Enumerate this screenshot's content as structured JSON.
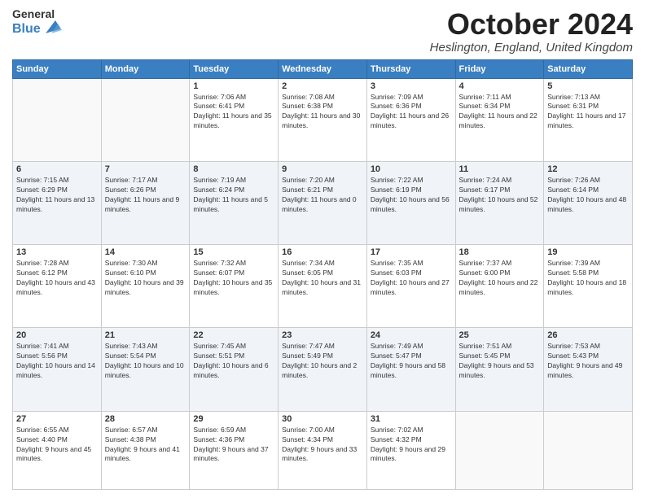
{
  "header": {
    "logo_general": "General",
    "logo_blue": "Blue",
    "month_title": "October 2024",
    "location": "Heslington, England, United Kingdom"
  },
  "days_of_week": [
    "Sunday",
    "Monday",
    "Tuesday",
    "Wednesday",
    "Thursday",
    "Friday",
    "Saturday"
  ],
  "weeks": [
    [
      {
        "day": "",
        "sunrise": "",
        "sunset": "",
        "daylight": ""
      },
      {
        "day": "",
        "sunrise": "",
        "sunset": "",
        "daylight": ""
      },
      {
        "day": "1",
        "sunrise": "Sunrise: 7:06 AM",
        "sunset": "Sunset: 6:41 PM",
        "daylight": "Daylight: 11 hours and 35 minutes."
      },
      {
        "day": "2",
        "sunrise": "Sunrise: 7:08 AM",
        "sunset": "Sunset: 6:38 PM",
        "daylight": "Daylight: 11 hours and 30 minutes."
      },
      {
        "day": "3",
        "sunrise": "Sunrise: 7:09 AM",
        "sunset": "Sunset: 6:36 PM",
        "daylight": "Daylight: 11 hours and 26 minutes."
      },
      {
        "day": "4",
        "sunrise": "Sunrise: 7:11 AM",
        "sunset": "Sunset: 6:34 PM",
        "daylight": "Daylight: 11 hours and 22 minutes."
      },
      {
        "day": "5",
        "sunrise": "Sunrise: 7:13 AM",
        "sunset": "Sunset: 6:31 PM",
        "daylight": "Daylight: 11 hours and 17 minutes."
      }
    ],
    [
      {
        "day": "6",
        "sunrise": "Sunrise: 7:15 AM",
        "sunset": "Sunset: 6:29 PM",
        "daylight": "Daylight: 11 hours and 13 minutes."
      },
      {
        "day": "7",
        "sunrise": "Sunrise: 7:17 AM",
        "sunset": "Sunset: 6:26 PM",
        "daylight": "Daylight: 11 hours and 9 minutes."
      },
      {
        "day": "8",
        "sunrise": "Sunrise: 7:19 AM",
        "sunset": "Sunset: 6:24 PM",
        "daylight": "Daylight: 11 hours and 5 minutes."
      },
      {
        "day": "9",
        "sunrise": "Sunrise: 7:20 AM",
        "sunset": "Sunset: 6:21 PM",
        "daylight": "Daylight: 11 hours and 0 minutes."
      },
      {
        "day": "10",
        "sunrise": "Sunrise: 7:22 AM",
        "sunset": "Sunset: 6:19 PM",
        "daylight": "Daylight: 10 hours and 56 minutes."
      },
      {
        "day": "11",
        "sunrise": "Sunrise: 7:24 AM",
        "sunset": "Sunset: 6:17 PM",
        "daylight": "Daylight: 10 hours and 52 minutes."
      },
      {
        "day": "12",
        "sunrise": "Sunrise: 7:26 AM",
        "sunset": "Sunset: 6:14 PM",
        "daylight": "Daylight: 10 hours and 48 minutes."
      }
    ],
    [
      {
        "day": "13",
        "sunrise": "Sunrise: 7:28 AM",
        "sunset": "Sunset: 6:12 PM",
        "daylight": "Daylight: 10 hours and 43 minutes."
      },
      {
        "day": "14",
        "sunrise": "Sunrise: 7:30 AM",
        "sunset": "Sunset: 6:10 PM",
        "daylight": "Daylight: 10 hours and 39 minutes."
      },
      {
        "day": "15",
        "sunrise": "Sunrise: 7:32 AM",
        "sunset": "Sunset: 6:07 PM",
        "daylight": "Daylight: 10 hours and 35 minutes."
      },
      {
        "day": "16",
        "sunrise": "Sunrise: 7:34 AM",
        "sunset": "Sunset: 6:05 PM",
        "daylight": "Daylight: 10 hours and 31 minutes."
      },
      {
        "day": "17",
        "sunrise": "Sunrise: 7:35 AM",
        "sunset": "Sunset: 6:03 PM",
        "daylight": "Daylight: 10 hours and 27 minutes."
      },
      {
        "day": "18",
        "sunrise": "Sunrise: 7:37 AM",
        "sunset": "Sunset: 6:00 PM",
        "daylight": "Daylight: 10 hours and 22 minutes."
      },
      {
        "day": "19",
        "sunrise": "Sunrise: 7:39 AM",
        "sunset": "Sunset: 5:58 PM",
        "daylight": "Daylight: 10 hours and 18 minutes."
      }
    ],
    [
      {
        "day": "20",
        "sunrise": "Sunrise: 7:41 AM",
        "sunset": "Sunset: 5:56 PM",
        "daylight": "Daylight: 10 hours and 14 minutes."
      },
      {
        "day": "21",
        "sunrise": "Sunrise: 7:43 AM",
        "sunset": "Sunset: 5:54 PM",
        "daylight": "Daylight: 10 hours and 10 minutes."
      },
      {
        "day": "22",
        "sunrise": "Sunrise: 7:45 AM",
        "sunset": "Sunset: 5:51 PM",
        "daylight": "Daylight: 10 hours and 6 minutes."
      },
      {
        "day": "23",
        "sunrise": "Sunrise: 7:47 AM",
        "sunset": "Sunset: 5:49 PM",
        "daylight": "Daylight: 10 hours and 2 minutes."
      },
      {
        "day": "24",
        "sunrise": "Sunrise: 7:49 AM",
        "sunset": "Sunset: 5:47 PM",
        "daylight": "Daylight: 9 hours and 58 minutes."
      },
      {
        "day": "25",
        "sunrise": "Sunrise: 7:51 AM",
        "sunset": "Sunset: 5:45 PM",
        "daylight": "Daylight: 9 hours and 53 minutes."
      },
      {
        "day": "26",
        "sunrise": "Sunrise: 7:53 AM",
        "sunset": "Sunset: 5:43 PM",
        "daylight": "Daylight: 9 hours and 49 minutes."
      }
    ],
    [
      {
        "day": "27",
        "sunrise": "Sunrise: 6:55 AM",
        "sunset": "Sunset: 4:40 PM",
        "daylight": "Daylight: 9 hours and 45 minutes."
      },
      {
        "day": "28",
        "sunrise": "Sunrise: 6:57 AM",
        "sunset": "Sunset: 4:38 PM",
        "daylight": "Daylight: 9 hours and 41 minutes."
      },
      {
        "day": "29",
        "sunrise": "Sunrise: 6:59 AM",
        "sunset": "Sunset: 4:36 PM",
        "daylight": "Daylight: 9 hours and 37 minutes."
      },
      {
        "day": "30",
        "sunrise": "Sunrise: 7:00 AM",
        "sunset": "Sunset: 4:34 PM",
        "daylight": "Daylight: 9 hours and 33 minutes."
      },
      {
        "day": "31",
        "sunrise": "Sunrise: 7:02 AM",
        "sunset": "Sunset: 4:32 PM",
        "daylight": "Daylight: 9 hours and 29 minutes."
      },
      {
        "day": "",
        "sunrise": "",
        "sunset": "",
        "daylight": ""
      },
      {
        "day": "",
        "sunrise": "",
        "sunset": "",
        "daylight": ""
      }
    ]
  ]
}
